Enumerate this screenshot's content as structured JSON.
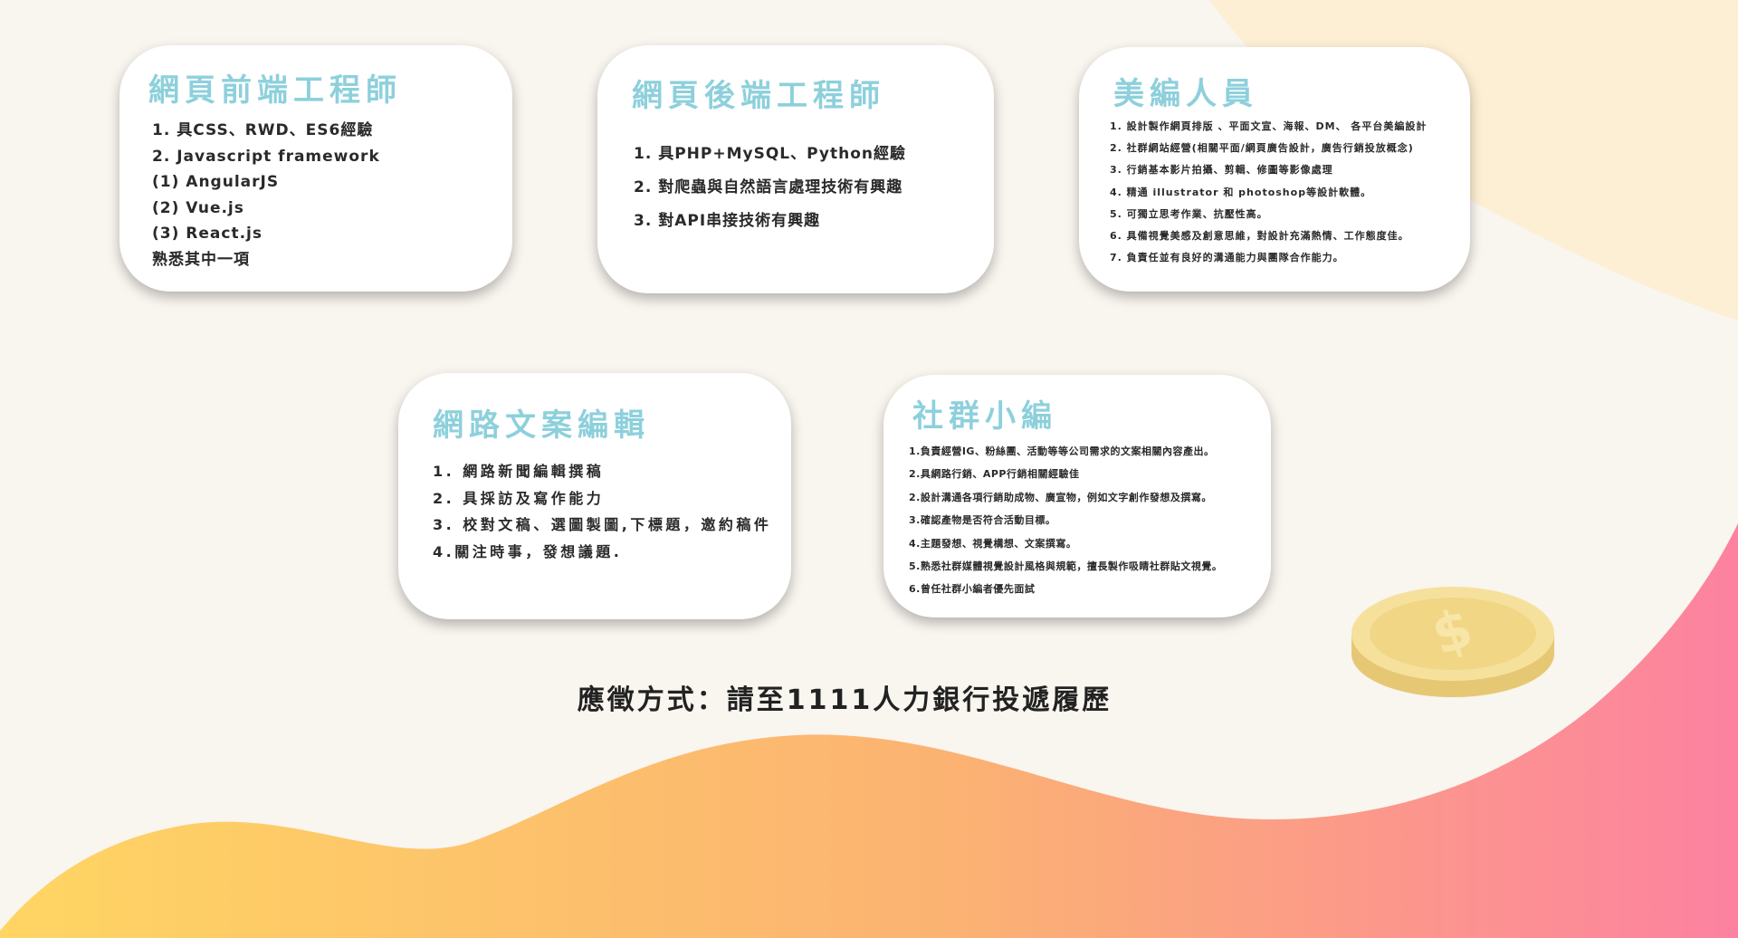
{
  "colors": {
    "background": "#f9f5ef",
    "title_color": "#8dd0dc",
    "wave_gradient_start": "#ffd563",
    "wave_gradient_mid": "#fbb272",
    "wave_gradient_end": "#fc82a0",
    "blob_color": "#fdefd3",
    "coin_face": "#f7e3a0",
    "coin_edge": "#eccf7e"
  },
  "cards": {
    "frontend": {
      "title": "網頁前端工程師",
      "items": [
        "1. 具CSS、RWD、ES6經驗",
        "2. Javascript framework",
        "(1) AngularJS",
        "(2) Vue.js",
        "(3) React.js",
        "熟悉其中一項"
      ]
    },
    "backend": {
      "title": "網頁後端工程師",
      "items": [
        "1. 具PHP+MySQL、Python經驗",
        "2. 對爬蟲與自然語言處理技術有興趣",
        "3. 對API串接技術有興趣"
      ]
    },
    "designer": {
      "title": "美編人員",
      "items": [
        "1. 設計製作網頁排版 、平面文宣、海報、DM、 各平台美編設計",
        "2. 社群網站經營(相關平面/網頁廣告設計，廣告行銷投放概念)",
        "3. 行銷基本影片拍攝、剪輯、修圖等影像處理",
        "4. 精通 illustrator 和 photoshop等設計軟體。",
        "5. 可獨立思考作業、抗壓性高。",
        "6. 具備視覺美感及創意思維，對設計充滿熱情、工作態度佳。",
        "7. 負責任並有良好的溝通能力與團隊合作能力。"
      ]
    },
    "copywriter": {
      "title": "網路文案編輯",
      "items": [
        "1. 網路新聞編輯撰稿",
        "2. 具採訪及寫作能力",
        "3. 校對文稿、選圖製圖,下標題，邀約稿件",
        "4.關注時事，發想議題."
      ]
    },
    "social": {
      "title": "社群小編",
      "items": [
        "1.負責經營IG、粉絲團、活動等等公司需求的文案相關內容產出。",
        "2.具網路行銷、APP行銷相關經驗佳",
        "2.設計溝通各項行銷助成物、廣宣物，例如文字創作發想及撰寫。",
        "3.確認產物是否符合活動目標。",
        "4.主題發想、視覺構想、文案撰寫。",
        "5.熟悉社群媒體視覺設計風格與規範，擅長製作吸睛社群貼文視覺。",
        "6.曾任社群小編者優先面試"
      ]
    }
  },
  "apply": {
    "text": "應徵方式：請至1111人力銀行投遞履歷"
  },
  "icons": {
    "coin": "dollar-coin-icon"
  }
}
